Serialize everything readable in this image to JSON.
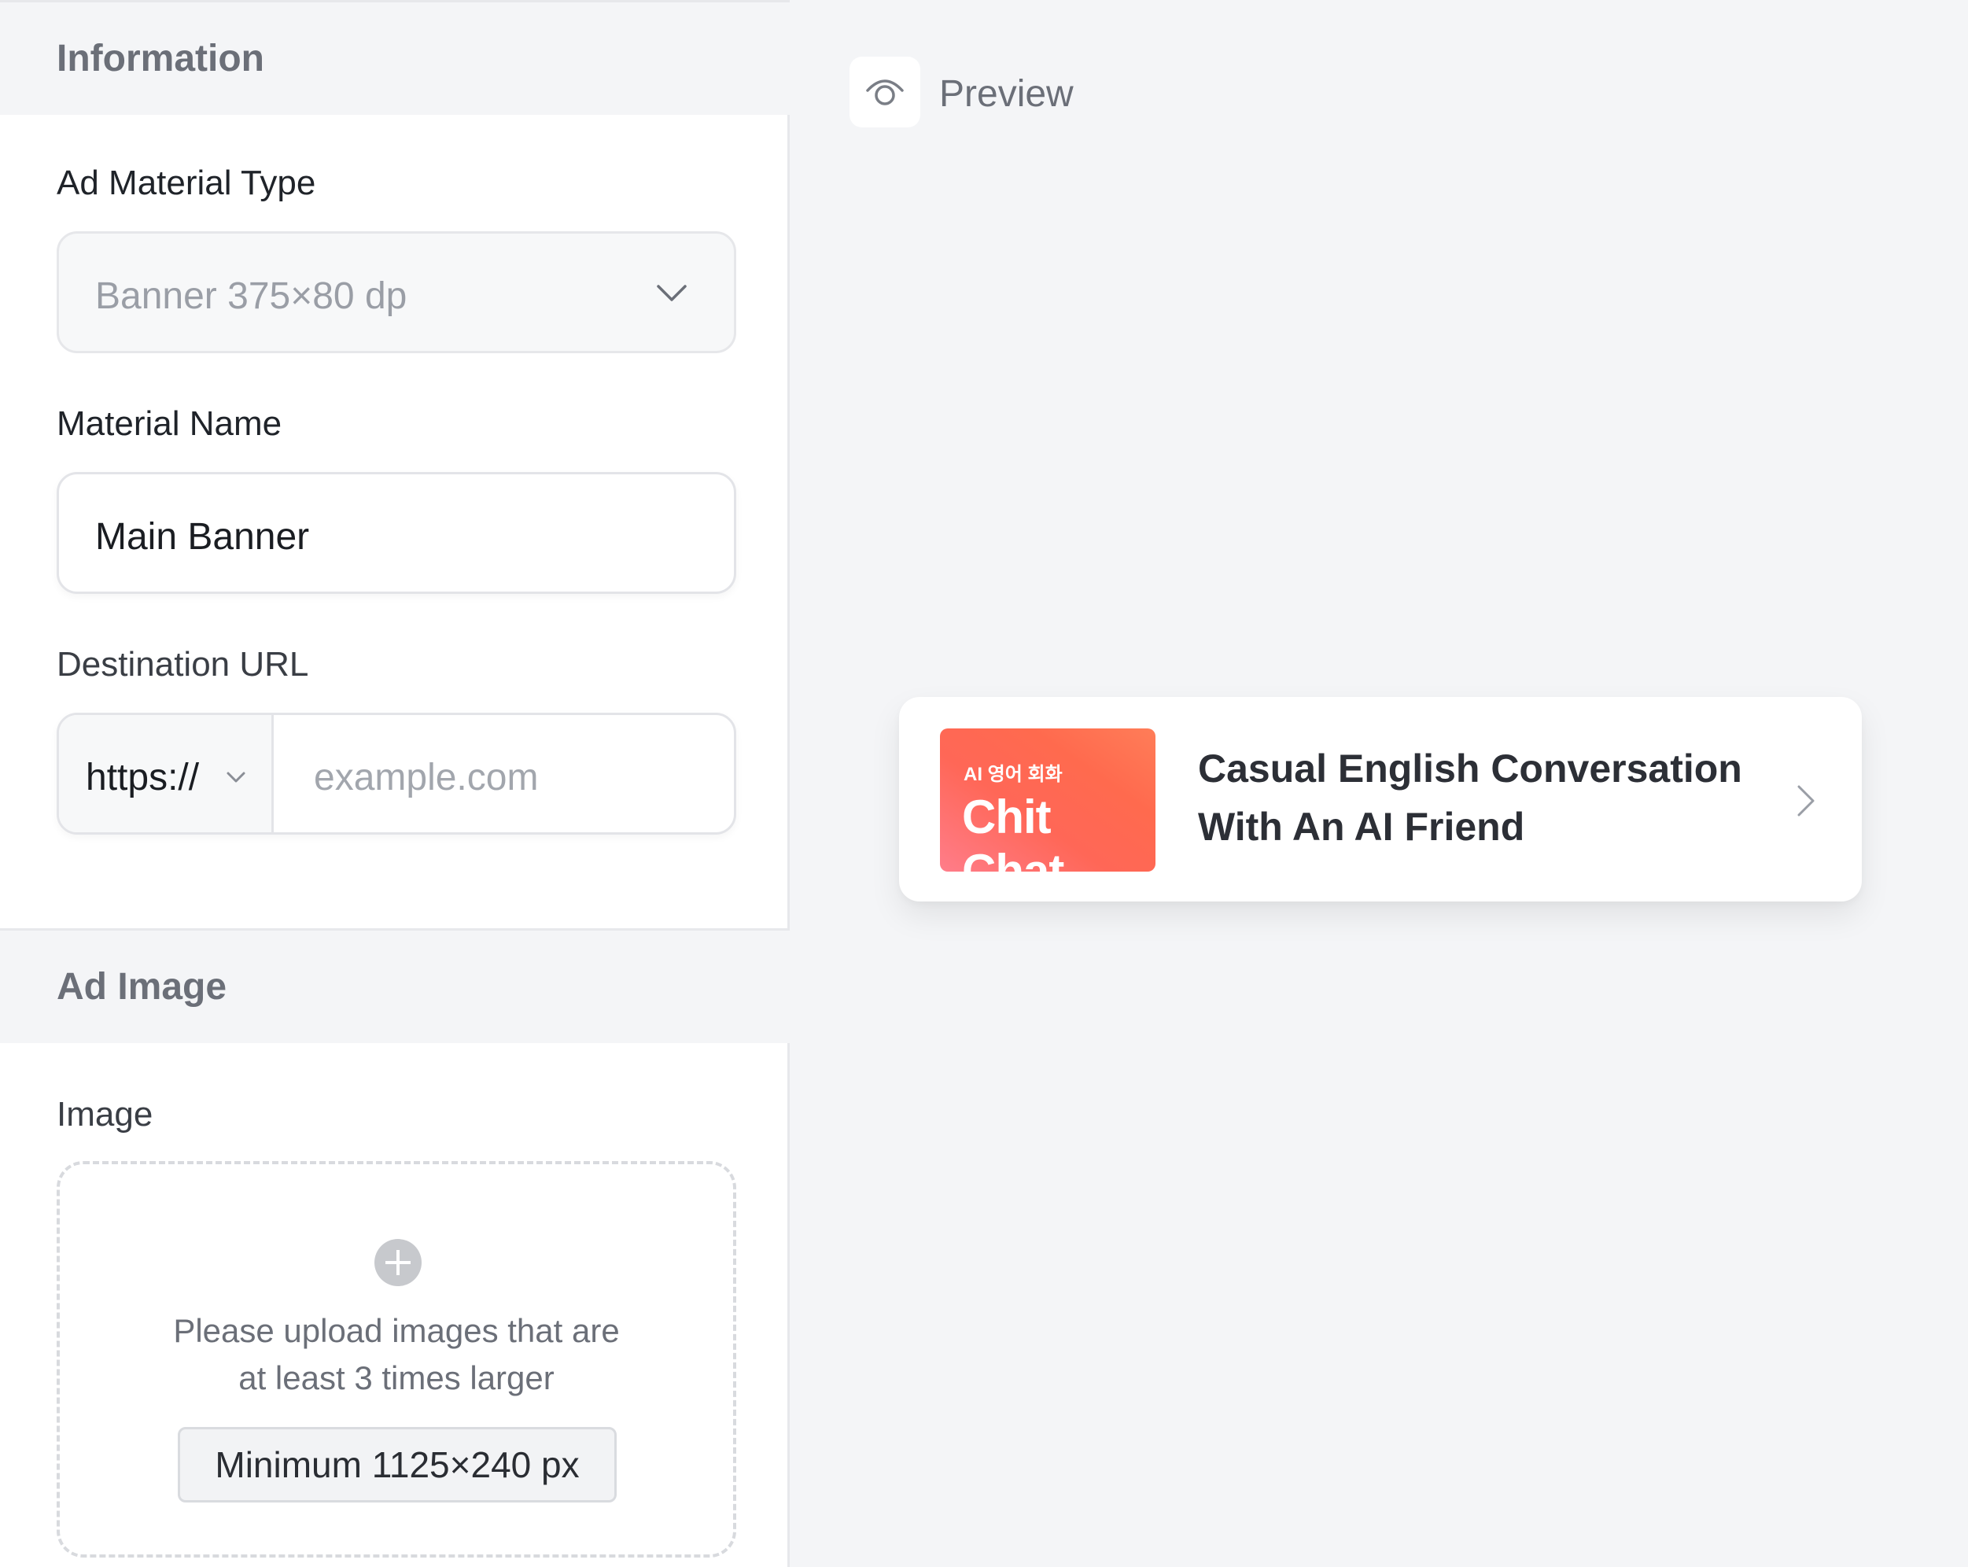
{
  "sections": {
    "information": "Information",
    "ad_image": "Ad Image"
  },
  "form": {
    "ad_material_type": {
      "label": "Ad Material Type",
      "value": "Banner 375×80 dp"
    },
    "material_name": {
      "label": "Material Name",
      "value": "Main Banner"
    },
    "destination_url": {
      "label": "Destination URL",
      "scheme": "https://",
      "placeholder": "example.com"
    },
    "image": {
      "label": "Image",
      "hint_line1": "Please upload images that are",
      "hint_line2": "at least 3 times larger",
      "minimum": "Minimum 1125×240 px"
    }
  },
  "preview": {
    "label": "Preview",
    "banner": {
      "thumb_small": "AI 영어 회화",
      "thumb_big": "Chit Chat",
      "title_line1": "Casual English Conversation",
      "title_line2": "With An AI Friend"
    }
  },
  "icons": {
    "select_chevron": "chevron-down-icon",
    "url_chevron": "chevron-down-icon",
    "upload": "plus-circle-icon",
    "preview": "eye-icon",
    "banner_arrow": "chevron-right-icon"
  },
  "colors": {
    "thumb_gradient_start": "#ff7d8a",
    "thumb_gradient_end": "#ff6a4e",
    "section_bg": "#f4f5f7"
  }
}
